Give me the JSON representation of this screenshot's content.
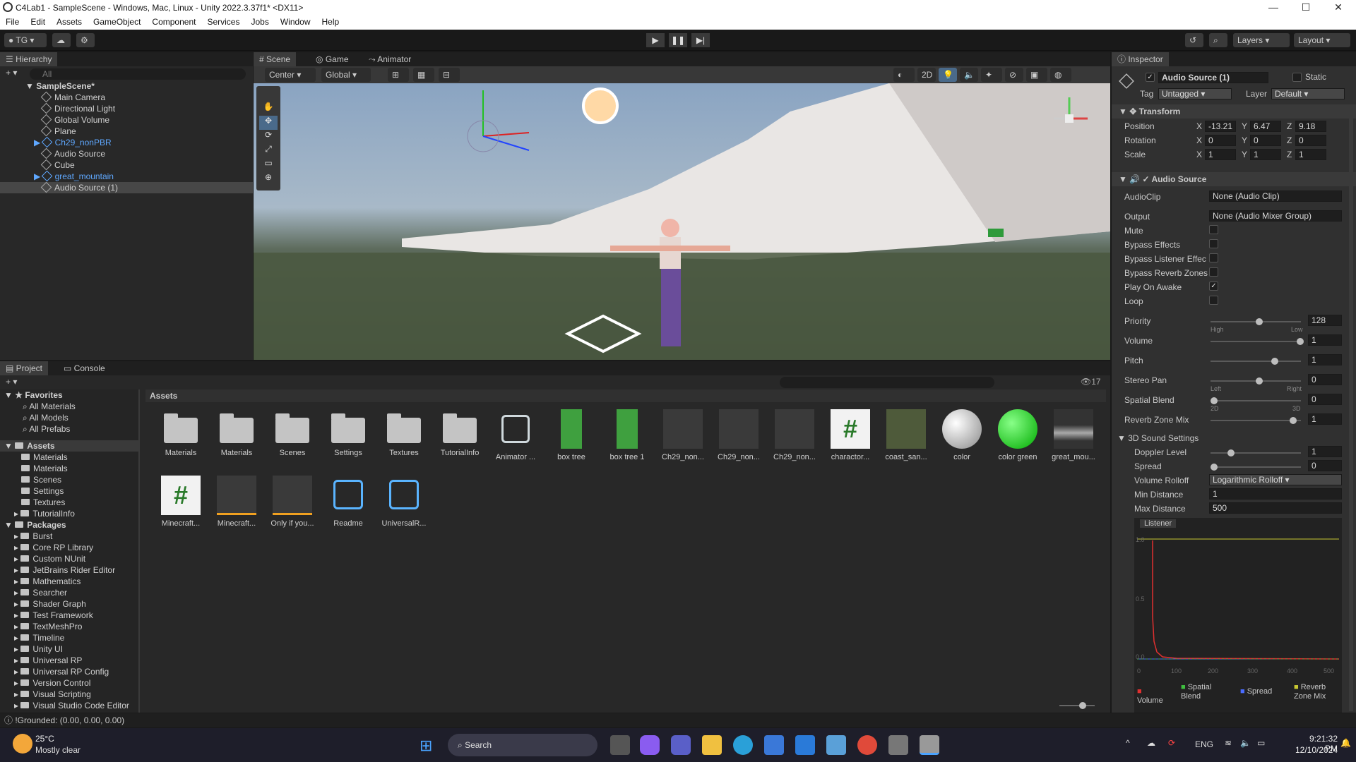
{
  "window": {
    "title": "C4Lab1 - SampleScene - Windows, Mac, Linux - Unity 2022.3.37f1* <DX11>",
    "minimize": "—",
    "maximize": "☐",
    "close": "✕"
  },
  "menu": [
    "File",
    "Edit",
    "Assets",
    "GameObject",
    "Component",
    "Services",
    "Jobs",
    "Window",
    "Help"
  ],
  "toolbar": {
    "account": "TG",
    "layers": "Layers",
    "layout": "Layout"
  },
  "hierarchy": {
    "tab": "Hierarchy",
    "search_placeholder": "All",
    "scene": "SampleScene*",
    "items": [
      "Main Camera",
      "Directional Light",
      "Global Volume",
      "Plane",
      "Ch29_nonPBR",
      "Audio Source",
      "Cube",
      "great_mountain",
      "Audio Source (1)"
    ]
  },
  "scene_tabs": [
    "Scene",
    "Game",
    "Animator"
  ],
  "scene_toolbar": {
    "pivot": "Center",
    "space": "Global",
    "mode2d": "2D"
  },
  "project": {
    "tabs": [
      "Project",
      "Console"
    ],
    "count": "17",
    "breadcrumb": "Assets",
    "favorites": {
      "label": "Favorites",
      "items": [
        "All Materials",
        "All Models",
        "All Prefabs"
      ]
    },
    "assets_root": "Assets",
    "assets_children": [
      "Materials",
      "Materials",
      "Scenes",
      "Settings",
      "Textures",
      "TutorialInfo"
    ],
    "packages_root": "Packages",
    "packages": [
      "Burst",
      "Core RP Library",
      "Custom NUnit",
      "JetBrains Rider Editor",
      "Mathematics",
      "Searcher",
      "Shader Graph",
      "Test Framework",
      "TextMeshPro",
      "Timeline",
      "Unity UI",
      "Universal RP",
      "Universal RP Config",
      "Version Control",
      "Visual Scripting",
      "Visual Studio Code Editor"
    ],
    "grid_row1": [
      "Materials",
      "Materials",
      "Scenes",
      "Settings",
      "Textures",
      "TutorialInfo",
      "Animator ...",
      "box tree",
      "box tree 1",
      "Ch29_non...",
      "Ch29_non...",
      "Ch29_non...",
      "charactor...",
      "coast_san...",
      "color",
      "color green",
      "great_mou..."
    ],
    "grid_row2": [
      "Minecraft...",
      "Minecraft...",
      "Only if you...",
      "Readme",
      "UniversalR..."
    ]
  },
  "status": "!Grounded: (0.00, 0.00, 0.00)",
  "inspector": {
    "tab": "Inspector",
    "object_name": "Audio Source (1)",
    "static": "Static",
    "tag_label": "Tag",
    "tag": "Untagged",
    "layer_label": "Layer",
    "layer": "Default",
    "transform": {
      "title": "Transform",
      "position_label": "Position",
      "rotation_label": "Rotation",
      "scale_label": "Scale",
      "position": [
        "-13.21",
        "6.47",
        "9.18"
      ],
      "rotation": [
        "0",
        "0",
        "0"
      ],
      "scale": [
        "1",
        "1",
        "1"
      ]
    },
    "audio": {
      "title": "Audio Source",
      "audioclip_label": "AudioClip",
      "audioclip": "None (Audio Clip)",
      "output_label": "Output",
      "output": "None (Audio Mixer Group)",
      "mute": "Mute",
      "bypass_effects": "Bypass Effects",
      "bypass_listener": "Bypass Listener Effec",
      "bypass_reverb": "Bypass Reverb Zones",
      "play_on_awake": "Play On Awake",
      "loop": "Loop",
      "priority_label": "Priority",
      "priority": "128",
      "priority_high": "High",
      "priority_low": "Low",
      "volume_label": "Volume",
      "volume": "1",
      "pitch_label": "Pitch",
      "pitch": "1",
      "stereo_label": "Stereo Pan",
      "stereo": "0",
      "stereo_left": "Left",
      "stereo_right": "Right",
      "spatial_label": "Spatial Blend",
      "spatial": "0",
      "spatial_2d": "2D",
      "spatial_3d": "3D",
      "reverb_label": "Reverb Zone Mix",
      "reverb": "1",
      "sound3d": "3D Sound Settings",
      "doppler_label": "Doppler Level",
      "doppler": "1",
      "spread_label": "Spread",
      "spread": "0",
      "rolloff_label": "Volume Rolloff",
      "rolloff": "Logarithmic Rolloff",
      "mindist_label": "Min Distance",
      "mindist": "1",
      "maxdist_label": "Max Distance",
      "maxdist": "500",
      "listener": "Listener",
      "graph_y": [
        "1.0",
        "0.5",
        "0.0"
      ],
      "graph_x": [
        "0",
        "100",
        "200",
        "300",
        "400",
        "500"
      ],
      "legend": [
        "Volume",
        "Spatial Blend",
        "Spread",
        "Reverb Zone Mix"
      ]
    }
  },
  "taskbar": {
    "temp": "25°C",
    "weather": "Mostly clear",
    "search": "Search",
    "lang": "ENG",
    "time": "9:21:32 PM",
    "date": "12/10/2024"
  },
  "colors": {
    "accent": "#2c5d87",
    "volume": "#e03030",
    "spatial": "#3fbf3f",
    "spread": "#4a6cff",
    "reverb": "#c8c832"
  }
}
